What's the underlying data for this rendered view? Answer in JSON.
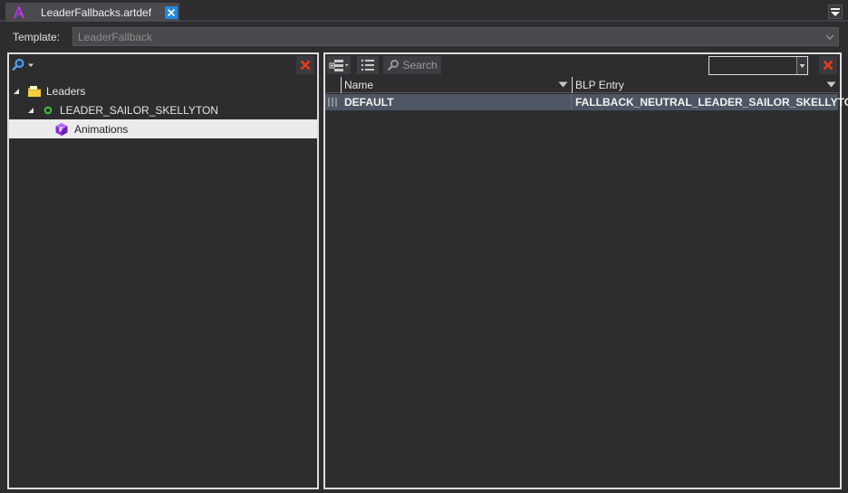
{
  "tab": {
    "title": "LeaderFallbacks.artdef",
    "close_icon": "close-icon",
    "accent": "#1e88e5"
  },
  "template": {
    "label": "Template:",
    "value": "LeaderFallback"
  },
  "tree": {
    "items": [
      {
        "label": "Leaders",
        "icon": "folder-icon",
        "expanded": true,
        "level": 0
      },
      {
        "label": "LEADER_SAILOR_SKELLYTON",
        "icon": "green-circle-icon",
        "expanded": true,
        "level": 1
      },
      {
        "label": "Animations",
        "icon": "purple-cube-icon",
        "selected": true,
        "level": 2
      }
    ]
  },
  "right_toolbar": {
    "search_label": "Search",
    "filter_value": ""
  },
  "grid": {
    "columns": [
      "Name",
      "BLP Entry"
    ],
    "rows": [
      {
        "name": "DEFAULT",
        "blp_entry": "FALLBACK_NEUTRAL_LEADER_SAILOR_SKELLYTON"
      }
    ]
  },
  "colors": {
    "background": "#2d2d30",
    "panel_border": "#dcdcdc",
    "selected_row": "#4e5563",
    "tree_selected": "#ebebeb",
    "close_red": "#e8391a"
  }
}
